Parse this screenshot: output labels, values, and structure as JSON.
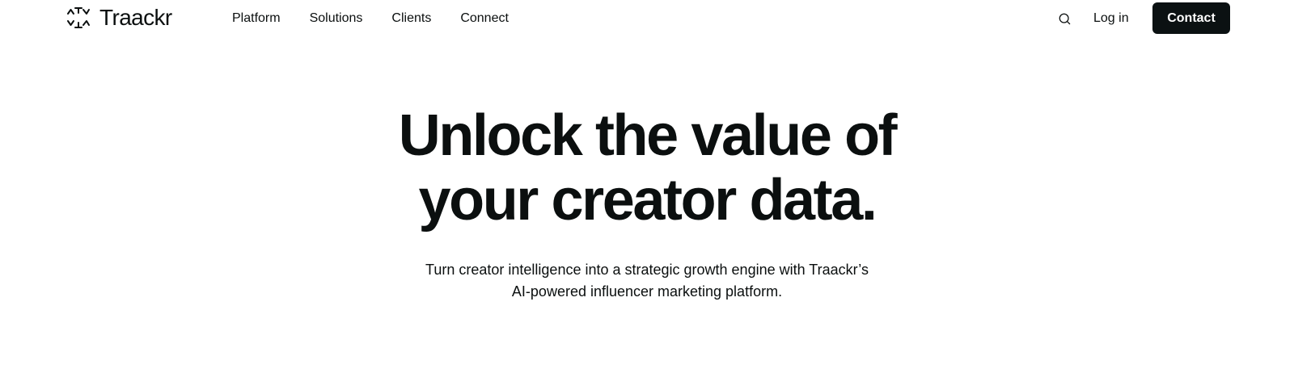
{
  "brand": {
    "name": "Traackr",
    "logo_icon": "traackr-logo-icon"
  },
  "nav": {
    "items": [
      {
        "label": "Platform"
      },
      {
        "label": "Solutions"
      },
      {
        "label": "Clients"
      },
      {
        "label": "Connect"
      }
    ]
  },
  "header_actions": {
    "search_icon": "search-icon",
    "login_label": "Log in",
    "contact_label": "Contact"
  },
  "hero": {
    "title_line1": "Unlock the value of",
    "title_line2": "your creator data.",
    "subtitle_line1": "Turn creator intelligence into a strategic growth engine with Traackr’s",
    "subtitle_line2": "AI-powered influencer marketing platform."
  },
  "colors": {
    "background": "#ffffff",
    "text": "#0b0f0f",
    "button_background": "#0b1112",
    "button_text": "#ffffff"
  }
}
